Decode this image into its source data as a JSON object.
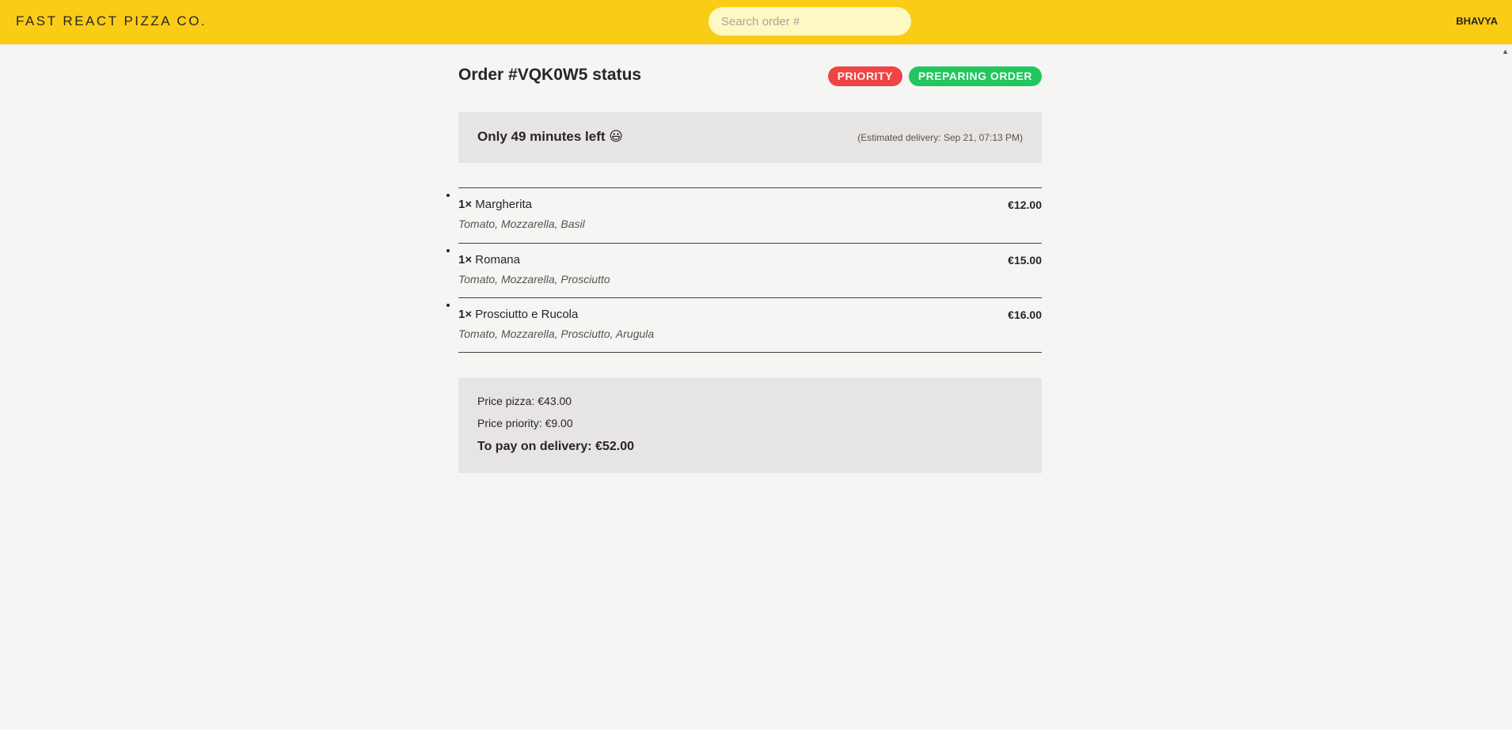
{
  "header": {
    "logo": "Fast React Pizza Co.",
    "search_placeholder": "Search order #",
    "search_value": "",
    "username": "Bhavya"
  },
  "order": {
    "title": "Order #VQK0W5 status",
    "badges": {
      "priority": "Priority",
      "status": "Preparing order"
    },
    "eta_left": "Only 49 minutes left 😃",
    "eta_right": "(Estimated delivery: Sep 21, 07:13 PM)"
  },
  "items": [
    {
      "qty": "1×",
      "name": "Margherita",
      "ingredients": "Tomato, Mozzarella, Basil",
      "price": "€12.00"
    },
    {
      "qty": "1×",
      "name": "Romana",
      "ingredients": "Tomato, Mozzarella, Prosciutto",
      "price": "€15.00"
    },
    {
      "qty": "1×",
      "name": "Prosciutto e Rucola",
      "ingredients": "Tomato, Mozzarella, Prosciutto, Arugula",
      "price": "€16.00"
    }
  ],
  "totals": {
    "price_pizza": "Price pizza: €43.00",
    "price_priority": "Price priority: €9.00",
    "to_pay": "To pay on delivery: €52.00"
  },
  "colors": {
    "header_bg": "#facc15",
    "priority_badge": "#ef4444",
    "status_badge": "#22c55e",
    "panel_bg": "#e7e5e4"
  },
  "icons": {
    "scroll_up": "scroll-up-arrow-icon"
  }
}
